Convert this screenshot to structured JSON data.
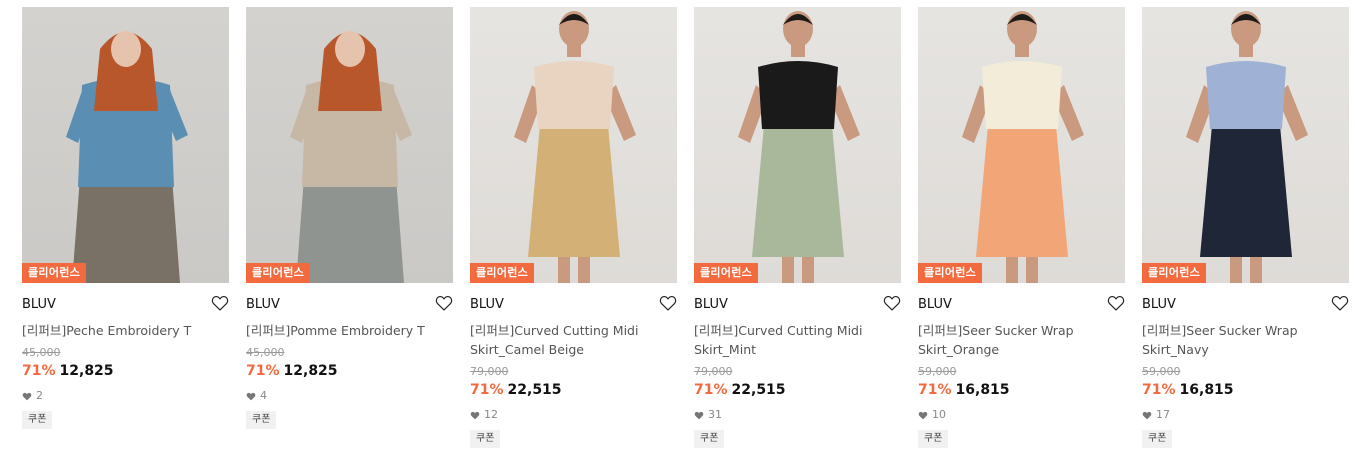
{
  "products": [
    {
      "tag": "클리어런스",
      "brand": "BLUV",
      "name": "[리퍼브]Peche Embroidery T",
      "original_price": "45,000",
      "discount": "71%",
      "price": "12,825",
      "likes": "2",
      "coupon": "쿠폰",
      "top_color": "#5a8fb3",
      "bottom_color": "#7a7166",
      "hair_color": "#b8572c",
      "skin_color": "#e6c3ad"
    },
    {
      "tag": "클리어런스",
      "brand": "BLUV",
      "name": "[리퍼브]Pomme Embroidery T",
      "original_price": "45,000",
      "discount": "71%",
      "price": "12,825",
      "likes": "4",
      "coupon": "쿠폰",
      "top_color": "#c7b8a6",
      "bottom_color": "#8f9491",
      "hair_color": "#b8572c",
      "skin_color": "#e6c3ad"
    },
    {
      "tag": "클리어런스",
      "brand": "BLUV",
      "name": "[리퍼브]Curved Cutting Midi Skirt_Camel Beige",
      "original_price": "79,000",
      "discount": "71%",
      "price": "22,515",
      "likes": "12",
      "coupon": "쿠폰",
      "top_color": "#e8d4c0",
      "bottom_color": "#d3b075",
      "hair_color": "#1f1a17",
      "skin_color": "#c99a80"
    },
    {
      "tag": "클리어런스",
      "brand": "BLUV",
      "name": "[리퍼브]Curved Cutting Midi Skirt_Mint",
      "original_price": "79,000",
      "discount": "71%",
      "price": "22,515",
      "likes": "31",
      "coupon": "쿠폰",
      "top_color": "#1a1a1a",
      "bottom_color": "#a9b79b",
      "hair_color": "#1f1a17",
      "skin_color": "#c99a80"
    },
    {
      "tag": "클리어런스",
      "brand": "BLUV",
      "name": "[리퍼브]Seer Sucker Wrap Skirt_Orange",
      "original_price": "59,000",
      "discount": "71%",
      "price": "16,815",
      "likes": "10",
      "coupon": "쿠폰",
      "top_color": "#f2ecd9",
      "bottom_color": "#f2a577",
      "hair_color": "#1f1a17",
      "skin_color": "#c99a80"
    },
    {
      "tag": "클리어런스",
      "brand": "BLUV",
      "name": "[리퍼브]Seer Sucker Wrap Skirt_Navy",
      "original_price": "59,000",
      "discount": "71%",
      "price": "16,815",
      "likes": "17",
      "coupon": "쿠폰",
      "top_color": "#9fb2d6",
      "bottom_color": "#1e2638",
      "hair_color": "#1f1a17",
      "skin_color": "#c99a80"
    }
  ]
}
